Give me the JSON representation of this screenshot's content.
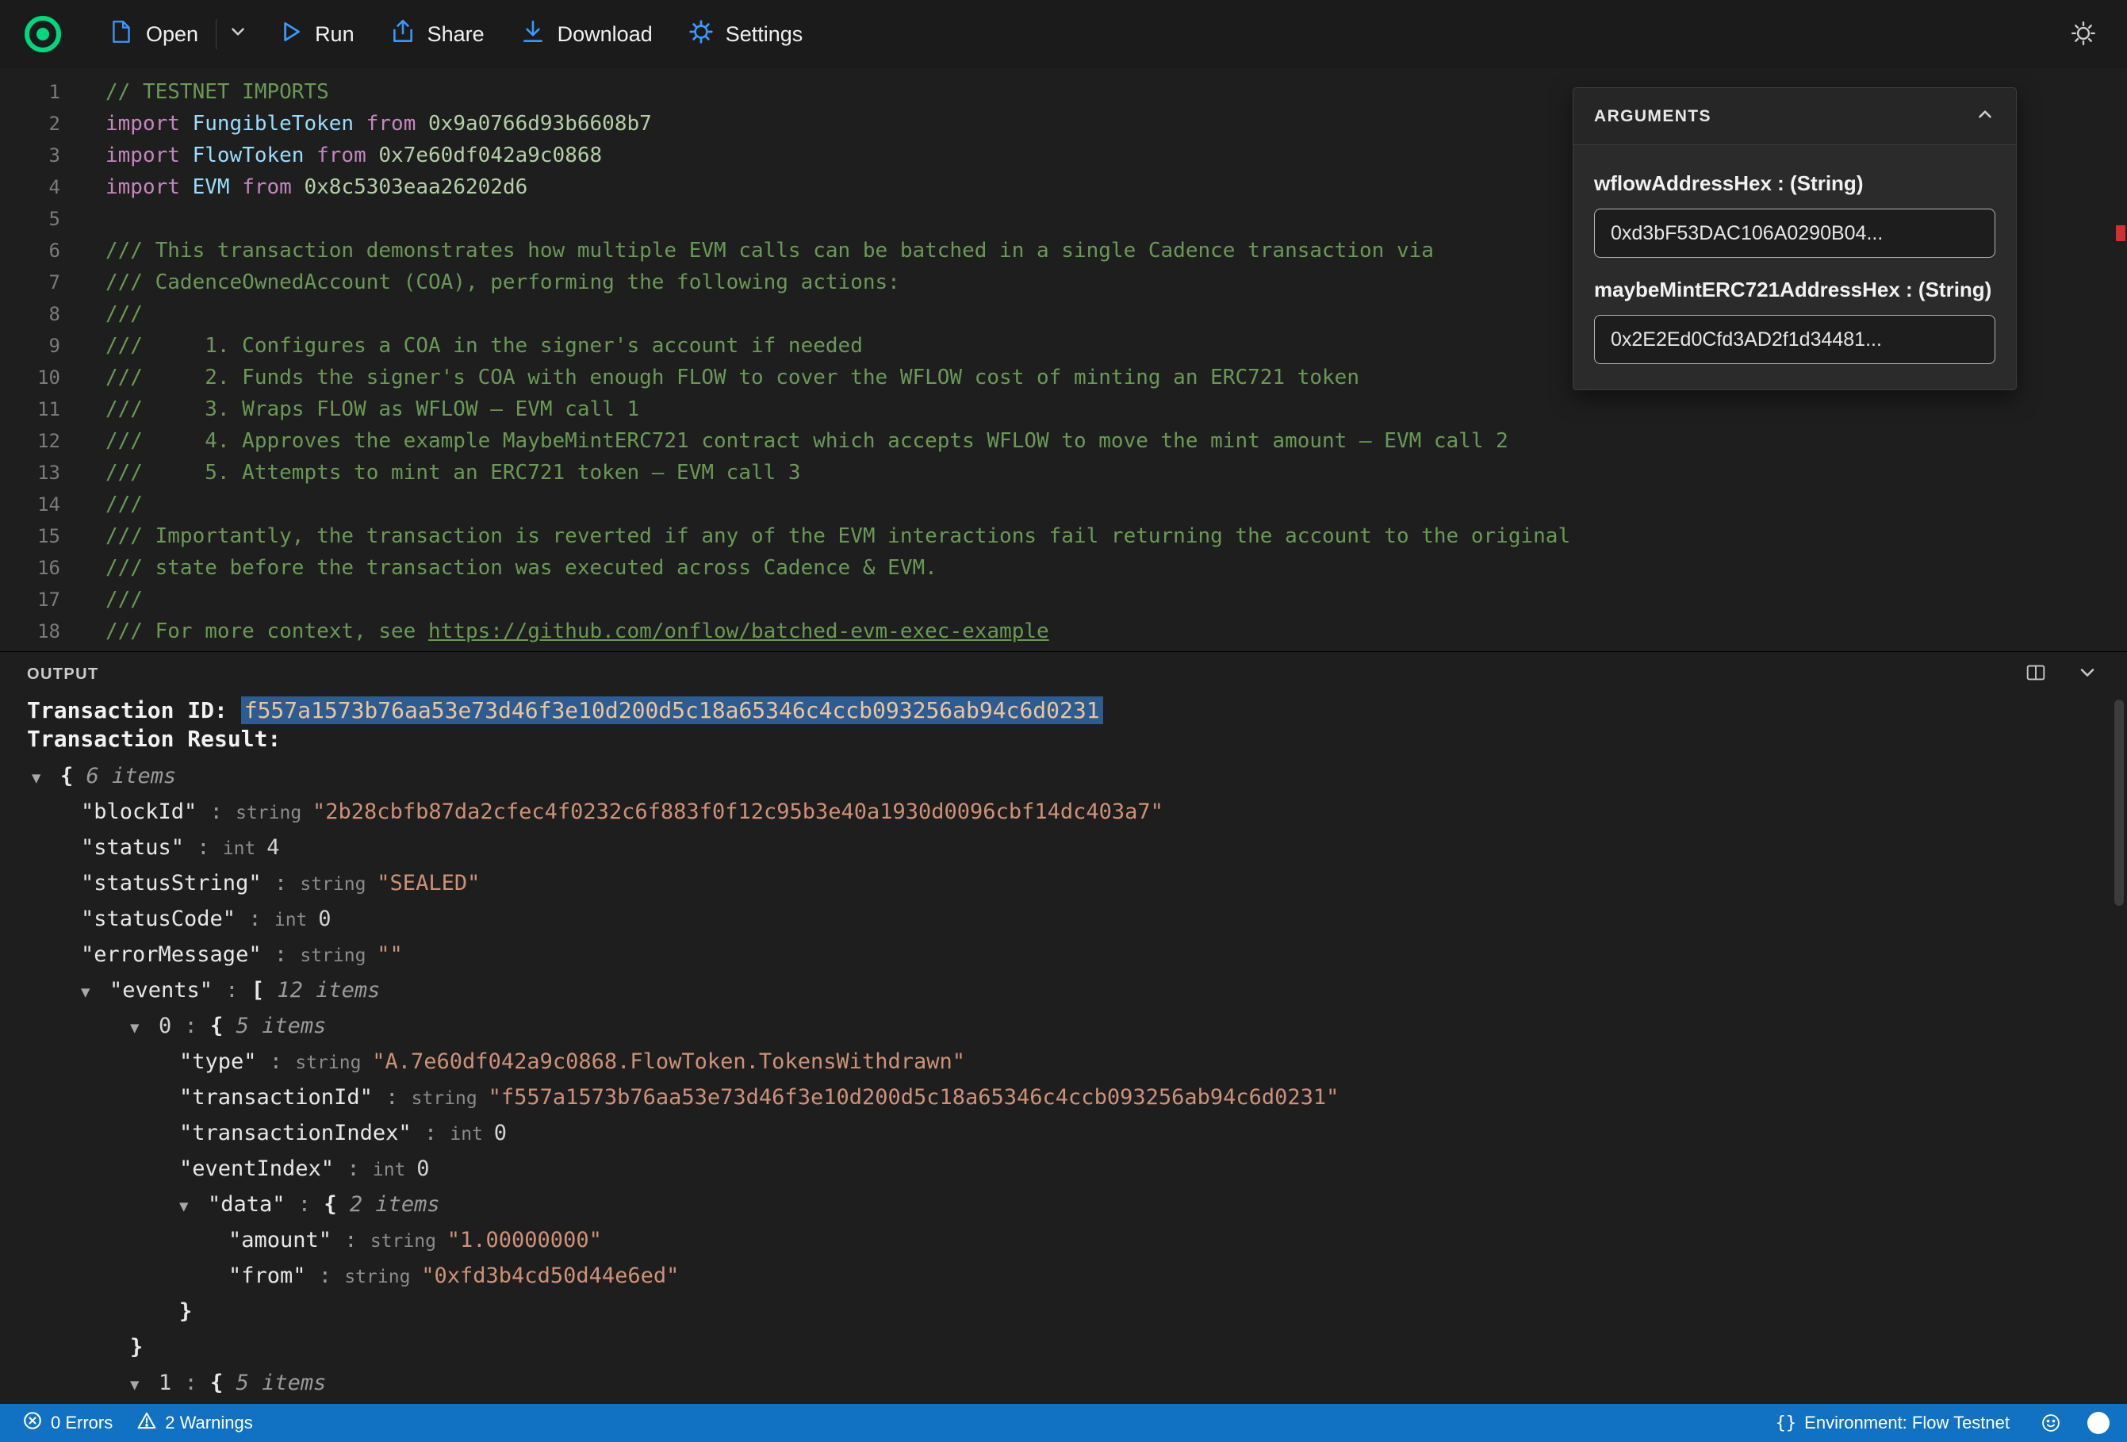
{
  "toolbar": {
    "open_label": "Open",
    "run_label": "Run",
    "share_label": "Share",
    "download_label": "Download",
    "settings_label": "Settings"
  },
  "editor": {
    "lines": [
      {
        "n": 1,
        "tokens": [
          {
            "t": "// TESTNET IMPORTS",
            "c": "comment"
          }
        ]
      },
      {
        "n": 2,
        "tokens": [
          {
            "t": "import ",
            "c": "kw"
          },
          {
            "t": "FungibleToken ",
            "c": "ident"
          },
          {
            "t": "from ",
            "c": "kw"
          },
          {
            "t": "0x9a0766d93b6608b7",
            "c": "num"
          }
        ]
      },
      {
        "n": 3,
        "tokens": [
          {
            "t": "import ",
            "c": "kw"
          },
          {
            "t": "FlowToken ",
            "c": "ident"
          },
          {
            "t": "from ",
            "c": "kw"
          },
          {
            "t": "0x7e60df042a9c0868",
            "c": "num"
          }
        ]
      },
      {
        "n": 4,
        "tokens": [
          {
            "t": "import ",
            "c": "kw"
          },
          {
            "t": "EVM ",
            "c": "ident"
          },
          {
            "t": "from ",
            "c": "kw"
          },
          {
            "t": "0x8c5303eaa26202d6",
            "c": "num"
          }
        ]
      },
      {
        "n": 5,
        "tokens": []
      },
      {
        "n": 6,
        "tokens": [
          {
            "t": "/// This transaction demonstrates how multiple EVM calls can be batched in a single Cadence transaction via",
            "c": "comment"
          }
        ]
      },
      {
        "n": 7,
        "tokens": [
          {
            "t": "/// CadenceOwnedAccount (COA), performing the following actions:",
            "c": "comment"
          }
        ]
      },
      {
        "n": 8,
        "tokens": [
          {
            "t": "///",
            "c": "comment"
          }
        ]
      },
      {
        "n": 9,
        "tokens": [
          {
            "t": "///     1. Configures a COA in the signer's account if needed",
            "c": "comment"
          }
        ]
      },
      {
        "n": 10,
        "tokens": [
          {
            "t": "///     2. Funds the signer's COA with enough FLOW to cover the WFLOW cost of minting an ERC721 token",
            "c": "comment"
          }
        ]
      },
      {
        "n": 11,
        "tokens": [
          {
            "t": "///     3. Wraps FLOW as WFLOW — EVM call 1",
            "c": "comment"
          }
        ]
      },
      {
        "n": 12,
        "tokens": [
          {
            "t": "///     4. Approves the example MaybeMintERC721 contract which accepts WFLOW to move the mint amount — EVM call 2",
            "c": "comment"
          }
        ]
      },
      {
        "n": 13,
        "tokens": [
          {
            "t": "///     5. Attempts to mint an ERC721 token — EVM call 3",
            "c": "comment"
          }
        ]
      },
      {
        "n": 14,
        "tokens": [
          {
            "t": "///",
            "c": "comment"
          }
        ]
      },
      {
        "n": 15,
        "tokens": [
          {
            "t": "/// Importantly, the transaction is reverted if any of the EVM interactions fail returning the account to the original",
            "c": "comment"
          }
        ]
      },
      {
        "n": 16,
        "tokens": [
          {
            "t": "/// state before the transaction was executed across Cadence & EVM.",
            "c": "comment"
          }
        ]
      },
      {
        "n": 17,
        "tokens": [
          {
            "t": "///",
            "c": "comment"
          }
        ]
      },
      {
        "n": 18,
        "tokens": [
          {
            "t": "/// For more context, see ",
            "c": "comment"
          },
          {
            "t": "https://github.com/onflow/batched-evm-exec-example",
            "c": "link"
          }
        ]
      }
    ]
  },
  "arguments": {
    "title": "ARGUMENTS",
    "args": [
      {
        "label": "wflowAddressHex : (String)",
        "value": "0xd3bF53DAC106A0290B04..."
      },
      {
        "label": "maybeMintERC721AddressHex : (String)",
        "value": "0x2E2Ed0Cfd3AD2f1d34481..."
      }
    ]
  },
  "output": {
    "title": "OUTPUT",
    "transaction_id_label": "Transaction ID: ",
    "transaction_id": "f557a1573b76aa53e73d46f3e10d200d5c18a65346c4ccb093256ab94c6d0231",
    "transaction_result_label": "Transaction Result:",
    "tree": [
      {
        "indent": 0,
        "arrow": true,
        "seg": [
          {
            "t": "{ ",
            "c": "brace"
          },
          {
            "t": "6 items",
            "c": "items"
          }
        ]
      },
      {
        "indent": 1,
        "arrow": false,
        "seg": [
          {
            "t": "\"blockId\"",
            "c": "key"
          },
          {
            "t": " : ",
            "c": "punct"
          },
          {
            "t": "string ",
            "c": "type"
          },
          {
            "t": "\"2b28cbfb87da2cfec4f0232c6f883f0f12c95b3e40a1930d0096cbf14dc403a7\"",
            "c": "str"
          }
        ]
      },
      {
        "indent": 1,
        "arrow": false,
        "seg": [
          {
            "t": "\"status\"",
            "c": "key"
          },
          {
            "t": " : ",
            "c": "punct"
          },
          {
            "t": "int ",
            "c": "type"
          },
          {
            "t": "4",
            "c": "num"
          }
        ]
      },
      {
        "indent": 1,
        "arrow": false,
        "seg": [
          {
            "t": "\"statusString\"",
            "c": "key"
          },
          {
            "t": " : ",
            "c": "punct"
          },
          {
            "t": "string ",
            "c": "type"
          },
          {
            "t": "\"SEALED\"",
            "c": "str"
          }
        ]
      },
      {
        "indent": 1,
        "arrow": false,
        "seg": [
          {
            "t": "\"statusCode\"",
            "c": "key"
          },
          {
            "t": " : ",
            "c": "punct"
          },
          {
            "t": "int ",
            "c": "type"
          },
          {
            "t": "0",
            "c": "num"
          }
        ]
      },
      {
        "indent": 1,
        "arrow": false,
        "seg": [
          {
            "t": "\"errorMessage\"",
            "c": "key"
          },
          {
            "t": " : ",
            "c": "punct"
          },
          {
            "t": "string ",
            "c": "type"
          },
          {
            "t": "\"\"",
            "c": "str"
          }
        ]
      },
      {
        "indent": 1,
        "arrow": true,
        "seg": [
          {
            "t": "\"events\"",
            "c": "key"
          },
          {
            "t": " : ",
            "c": "punct"
          },
          {
            "t": "[ ",
            "c": "brace"
          },
          {
            "t": "12 items",
            "c": "items"
          }
        ]
      },
      {
        "indent": 2,
        "arrow": true,
        "seg": [
          {
            "t": "0",
            "c": "idx"
          },
          {
            "t": " : ",
            "c": "punct"
          },
          {
            "t": "{ ",
            "c": "brace"
          },
          {
            "t": "5 items",
            "c": "items"
          }
        ]
      },
      {
        "indent": 3,
        "arrow": false,
        "seg": [
          {
            "t": "\"type\"",
            "c": "key"
          },
          {
            "t": " : ",
            "c": "punct"
          },
          {
            "t": "string ",
            "c": "type"
          },
          {
            "t": "\"A.7e60df042a9c0868.FlowToken.TokensWithdrawn\"",
            "c": "str"
          }
        ]
      },
      {
        "indent": 3,
        "arrow": false,
        "seg": [
          {
            "t": "\"transactionId\"",
            "c": "key"
          },
          {
            "t": " : ",
            "c": "punct"
          },
          {
            "t": "string ",
            "c": "type"
          },
          {
            "t": "\"f557a1573b76aa53e73d46f3e10d200d5c18a65346c4ccb093256ab94c6d0231\"",
            "c": "str"
          }
        ]
      },
      {
        "indent": 3,
        "arrow": false,
        "seg": [
          {
            "t": "\"transactionIndex\"",
            "c": "key"
          },
          {
            "t": " : ",
            "c": "punct"
          },
          {
            "t": "int ",
            "c": "type"
          },
          {
            "t": "0",
            "c": "num"
          }
        ]
      },
      {
        "indent": 3,
        "arrow": false,
        "seg": [
          {
            "t": "\"eventIndex\"",
            "c": "key"
          },
          {
            "t": " : ",
            "c": "punct"
          },
          {
            "t": "int ",
            "c": "type"
          },
          {
            "t": "0",
            "c": "num"
          }
        ]
      },
      {
        "indent": 3,
        "arrow": true,
        "seg": [
          {
            "t": "\"data\"",
            "c": "key"
          },
          {
            "t": " : ",
            "c": "punct"
          },
          {
            "t": "{ ",
            "c": "brace"
          },
          {
            "t": "2 items",
            "c": "items"
          }
        ]
      },
      {
        "indent": 4,
        "arrow": false,
        "seg": [
          {
            "t": "\"amount\"",
            "c": "key"
          },
          {
            "t": " : ",
            "c": "punct"
          },
          {
            "t": "string ",
            "c": "type"
          },
          {
            "t": "\"1.00000000\"",
            "c": "str"
          }
        ]
      },
      {
        "indent": 4,
        "arrow": false,
        "seg": [
          {
            "t": "\"from\"",
            "c": "key"
          },
          {
            "t": " : ",
            "c": "punct"
          },
          {
            "t": "string ",
            "c": "type"
          },
          {
            "t": "\"0xfd3b4cd50d44e6ed\"",
            "c": "str"
          }
        ]
      },
      {
        "indent": 3,
        "arrow": false,
        "seg": [
          {
            "t": "}",
            "c": "brace"
          }
        ]
      },
      {
        "indent": 2,
        "arrow": false,
        "seg": [
          {
            "t": "}",
            "c": "brace"
          }
        ]
      },
      {
        "indent": 2,
        "arrow": true,
        "seg": [
          {
            "t": "1",
            "c": "idx"
          },
          {
            "t": " : ",
            "c": "punct"
          },
          {
            "t": "{ ",
            "c": "brace"
          },
          {
            "t": "5 items",
            "c": "items"
          }
        ]
      }
    ]
  },
  "statusbar": {
    "errors": "0 Errors",
    "warnings": "2 Warnings",
    "env_icon": "{}",
    "environment": "Environment: Flow Testnet"
  },
  "colors": {
    "flow_green": "#00D87E",
    "accent_blue": "#3B99FC",
    "statusbar_blue": "#1172C3",
    "comment_green": "#6A9955",
    "string_orange": "#CE9178",
    "selection_blue": "#2E5C90",
    "error_red": "#CF3131"
  }
}
